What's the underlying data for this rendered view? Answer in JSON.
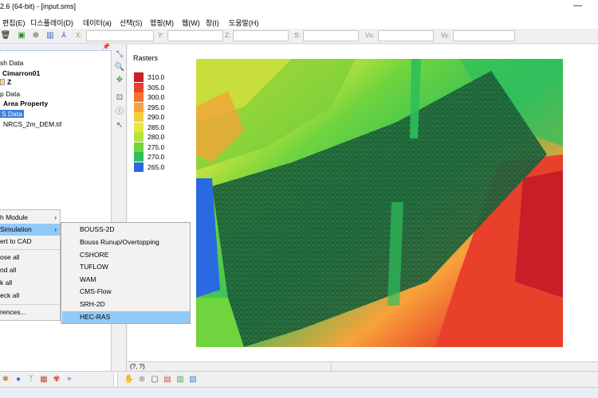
{
  "window": {
    "title": "2.6 (64-bit) - [input.sms]",
    "minimize_glyph": "—"
  },
  "menubar": [
    "편집(E)",
    "디스플레이(D)",
    "데이터(a)",
    "선택(S)",
    "맵핑(M)",
    "웹(W)",
    "창(I)",
    "도움말(H)"
  ],
  "toolbar": {
    "icons": [
      "trash-icon",
      "save-icon",
      "zoom-icon",
      "display-icon",
      "plot-icon"
    ],
    "coords": [
      "X:",
      "Y:",
      "Z:",
      "S:",
      "Vx:",
      "Vy:"
    ]
  },
  "tree": [
    {
      "label": "sh Data",
      "bold": false
    },
    {
      "label": "Cimarron01",
      "bold": true
    },
    {
      "label": "Z",
      "bold": true
    },
    {
      "label": "p Data",
      "bold": false
    },
    {
      "label": "Area Property",
      "bold": true
    },
    {
      "label": "S Data",
      "bold": false,
      "selected": true
    },
    {
      "label": "NRCS_2m_DEM.tif",
      "bold": false
    }
  ],
  "context_menu": [
    {
      "label": "h Module",
      "arrow": "›"
    },
    {
      "label": "Simulation",
      "arrow": "›",
      "active": true
    },
    {
      "label": "ert to CAD"
    },
    {
      "label": "ose all"
    },
    {
      "label": "nd all"
    },
    {
      "label": "k all"
    },
    {
      "label": "eck all"
    },
    {
      "label": "rences..."
    }
  ],
  "submenu": [
    "BOUSS-2D",
    "Bouss Runup/Overtopping",
    "CSHORE",
    "TUFLOW",
    "WAM",
    "CMS-Flow",
    "SRH-2D",
    "HEC-RAS"
  ],
  "submenu_active": "HEC-RAS",
  "legend": {
    "title": "Rasters",
    "items": [
      {
        "label": "310.0",
        "color": "#c81e28"
      },
      {
        "label": "305.0",
        "color": "#e8402a"
      },
      {
        "label": "300.0",
        "color": "#f5732c"
      },
      {
        "label": "295.0",
        "color": "#f8a23a"
      },
      {
        "label": "290.0",
        "color": "#f8cd3a"
      },
      {
        "label": "285.0",
        "color": "#e7e83c"
      },
      {
        "label": "280.0",
        "color": "#b5e23c"
      },
      {
        "label": "275.0",
        "color": "#6fd43e"
      },
      {
        "label": "270.0",
        "color": "#2fbf5c"
      },
      {
        "label": "265.0",
        "color": "#2a6ae0"
      }
    ]
  },
  "status": {
    "coord": "(?, ?)"
  }
}
